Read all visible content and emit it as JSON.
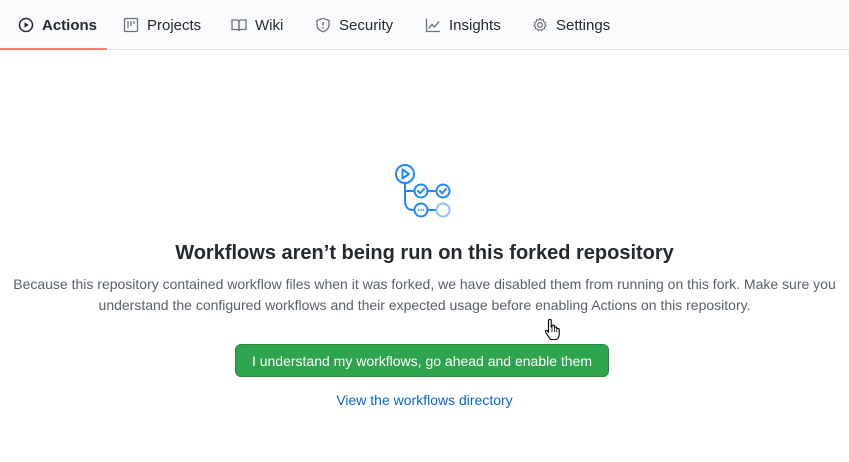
{
  "tabs": [
    {
      "label": "Actions",
      "icon": "play-icon",
      "active": true
    },
    {
      "label": "Projects",
      "icon": "project-icon",
      "active": false
    },
    {
      "label": "Wiki",
      "icon": "book-icon",
      "active": false
    },
    {
      "label": "Security",
      "icon": "shield-icon",
      "active": false
    },
    {
      "label": "Insights",
      "icon": "graph-icon",
      "active": false
    },
    {
      "label": "Settings",
      "icon": "gear-icon",
      "active": false
    }
  ],
  "blankslate": {
    "icon": "workflow-icon",
    "title": "Workflows aren’t being run on this forked repository",
    "description_line1": "Because this repository contained workflow files when it was forked, we have disabled them from running on this fork. Make sure you",
    "description_line2": "understand the configured workflows and their expected usage before enabling Actions on this repository.",
    "enable_button": "I understand my workflows, go ahead and enable them",
    "directory_link": "View the workflows directory"
  },
  "colors": {
    "accent_underline": "#f9826c",
    "button_green": "#2ea44f",
    "link_blue": "#0366d6",
    "icon_blue": "#2188ff"
  }
}
